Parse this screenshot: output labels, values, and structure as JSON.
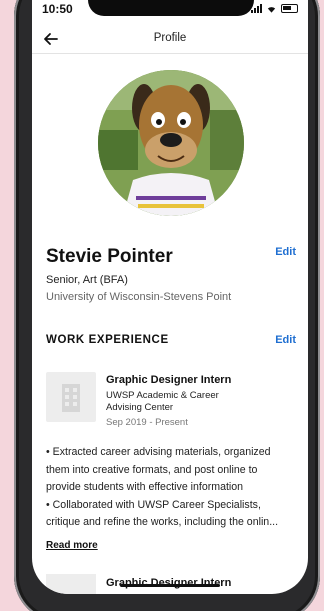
{
  "status": {
    "time": "10:50"
  },
  "nav": {
    "title": "Profile"
  },
  "profile": {
    "name": "Stevie Pointer",
    "edit_label": "Edit",
    "degree": "Senior, Art (BFA)",
    "school": "University of Wisconsin-Stevens Point"
  },
  "work": {
    "section_title": "WORK EXPERIENCE",
    "edit_label": "Edit",
    "items": [
      {
        "title": "Graphic Designer Intern",
        "org_line1": "UWSP Academic & Career",
        "org_line2": "Advising Center",
        "dates": "Sep 2019 - Present",
        "desc_line1": "• Extracted career advising materials, organized",
        "desc_line2": "them into creative formats, and post online to",
        "desc_line3": "provide students with effective information",
        "desc_line4": "• Collaborated with UWSP Career Specialists,",
        "desc_line5": "critique and refine the works, including the onlin...",
        "read_more": "Read more"
      },
      {
        "title": "Graphic Designer Intern"
      }
    ]
  },
  "colors": {
    "accent": "#1f6fd1",
    "background": "#f4d6dc"
  }
}
